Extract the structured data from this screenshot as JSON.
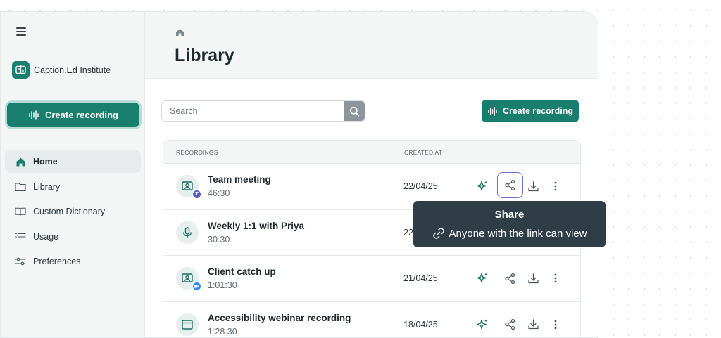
{
  "sidebar": {
    "brand_name": "Caption.Ed Institute",
    "create_label": "Create recording",
    "nav": [
      {
        "label": "Home",
        "icon": "home-icon",
        "active": true
      },
      {
        "label": "Library",
        "icon": "folder-icon"
      },
      {
        "label": "Custom Dictionary",
        "icon": "book-icon"
      },
      {
        "label": "Usage",
        "icon": "list-icon"
      },
      {
        "label": "Preferences",
        "icon": "sliders-icon"
      }
    ]
  },
  "main": {
    "title": "Library",
    "search_placeholder": "Search",
    "create_label": "Create recording"
  },
  "table": {
    "col_recordings": "RECORDINGS",
    "col_created": "CREATED AT",
    "rows": [
      {
        "title": "Team meeting",
        "duration": "46:30",
        "date": "22/04/25",
        "icon": "video-call-icon",
        "source": "teams-badge"
      },
      {
        "title": "Weekly 1:1 with Priya",
        "duration": "30:30",
        "date": "22/04/25",
        "icon": "microphone-icon"
      },
      {
        "title": "Client catch up",
        "duration": "1:01:30",
        "date": "21/04/25",
        "icon": "video-call-icon",
        "source": "zoom-badge"
      },
      {
        "title": "Accessibility webinar recording",
        "duration": "1:28:30",
        "date": "18/04/25",
        "icon": "browser-window-icon"
      }
    ]
  },
  "tooltip": {
    "title": "Share",
    "description": "Anyone with the link can view"
  },
  "colors": {
    "brand": "#1a7e6e",
    "focus_ring": "#6b6fd8",
    "tooltip_bg": "#2f3e46",
    "teams": "#5b5fc7",
    "zoom": "#2d8cff"
  }
}
